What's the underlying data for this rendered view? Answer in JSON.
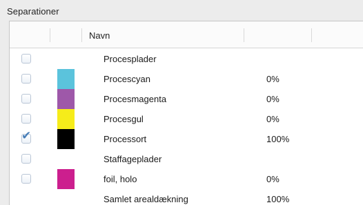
{
  "panel": {
    "title": "Separationer"
  },
  "table": {
    "header": {
      "name_label": "Navn"
    },
    "rows": [
      {
        "checkbox": "visible",
        "checked": false,
        "swatch": null,
        "name": "Procesplader",
        "coverage": ""
      },
      {
        "checkbox": "visible",
        "checked": false,
        "swatch": "#5bc3dc",
        "name": "Procescyan",
        "coverage": "0%"
      },
      {
        "checkbox": "visible",
        "checked": false,
        "swatch": "#9e58a9",
        "name": "Procesmagenta",
        "coverage": "0%"
      },
      {
        "checkbox": "visible",
        "checked": false,
        "swatch": "#f6ec1a",
        "name": "Procesgul",
        "coverage": "0%"
      },
      {
        "checkbox": "visible",
        "checked": true,
        "swatch": "#000000",
        "name": "Processort",
        "coverage": "100%"
      },
      {
        "checkbox": "visible",
        "checked": false,
        "swatch": null,
        "name": "Staffageplader",
        "coverage": ""
      },
      {
        "checkbox": "visible",
        "checked": false,
        "swatch": "#cc1f8e",
        "name": "foil, holo",
        "coverage": "0%"
      },
      {
        "checkbox": "none",
        "checked": false,
        "swatch": null,
        "name": "Samlet arealdækning",
        "coverage": "100%"
      }
    ]
  }
}
